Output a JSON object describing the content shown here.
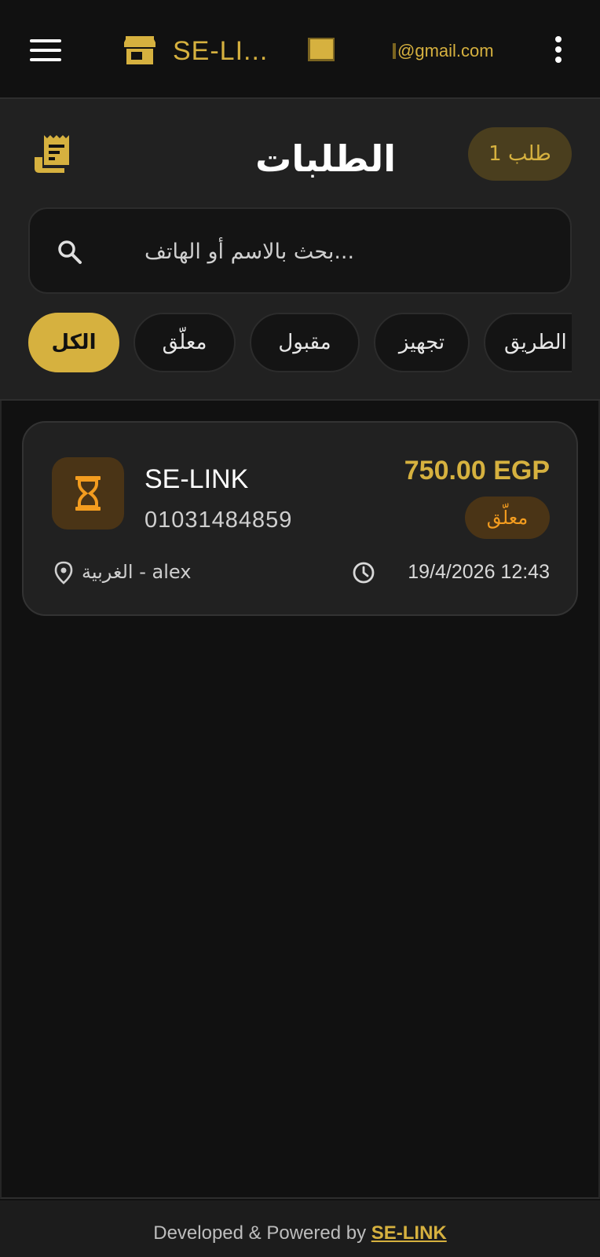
{
  "topbar": {
    "brand_title": "SE-LI...",
    "email": "@gmail.com",
    "accent_color": "#d6b13f"
  },
  "header": {
    "title": "الطلبات",
    "count_badge": "طلب 1",
    "icon": "receipt-icon"
  },
  "search": {
    "placeholder": "...بحث بالاسم أو الهاتف",
    "value": ""
  },
  "filters": [
    {
      "label": "الكل",
      "active": true
    },
    {
      "label": "معلّق",
      "active": false
    },
    {
      "label": "مقبول",
      "active": false
    },
    {
      "label": "تجهيز",
      "active": false
    },
    {
      "label": "الطريق",
      "active": false
    }
  ],
  "orders": [
    {
      "customer_name": "SE-LINK",
      "phone": "01031484859",
      "price": "750.00 EGP",
      "status": "معلّق",
      "status_icon": "hourglass-icon",
      "location": "الغربية - alex",
      "datetime": "19/4/2026 12:43"
    }
  ],
  "footer": {
    "prefix": "Developed & Powered by ",
    "link": "SE-LINK"
  }
}
